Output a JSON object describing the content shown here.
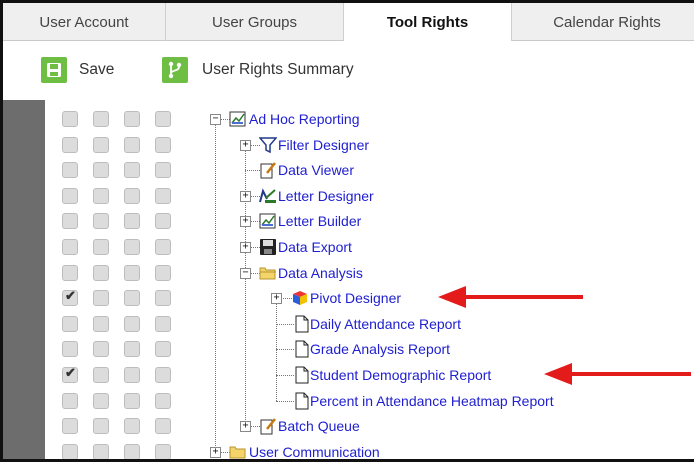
{
  "tabs": [
    {
      "label": "User Account",
      "active": false
    },
    {
      "label": "User Groups",
      "active": false
    },
    {
      "label": "Tool Rights",
      "active": true
    },
    {
      "label": "Calendar Rights",
      "active": false
    }
  ],
  "toolbar": {
    "save_label": "Save",
    "summary_label": "User Rights Summary",
    "accent_color": "#6fbe44"
  },
  "tree": [
    {
      "label": "Ad Hoc Reporting",
      "icon": "report-icon",
      "checked": false
    },
    {
      "label": "Filter Designer",
      "icon": "filter-icon",
      "checked": false
    },
    {
      "label": "Data Viewer",
      "icon": "document-edit-icon",
      "checked": false
    },
    {
      "label": "Letter Designer",
      "icon": "letter-designer-icon",
      "checked": false
    },
    {
      "label": "Letter Builder",
      "icon": "report-icon",
      "checked": false
    },
    {
      "label": "Data Export",
      "icon": "floppy-disk-icon",
      "checked": false
    },
    {
      "label": "Data Analysis",
      "icon": "folder-open-icon",
      "checked": false
    },
    {
      "label": "Pivot Designer",
      "icon": "cube-icon",
      "checked": true
    },
    {
      "label": "Daily Attendance Report",
      "icon": "page-icon",
      "checked": false
    },
    {
      "label": "Grade Analysis Report",
      "icon": "page-icon",
      "checked": false
    },
    {
      "label": "Student Demographic Report",
      "icon": "page-icon",
      "checked": true
    },
    {
      "label": "Percent in Attendance Heatmap Report",
      "icon": "page-icon",
      "checked": false
    },
    {
      "label": "Batch Queue",
      "icon": "document-edit-icon",
      "checked": false
    },
    {
      "label": "User Communication",
      "icon": "folder-icon",
      "checked": false
    }
  ],
  "colors": {
    "link": "#2020d0",
    "annotation_arrow": "#e31b1b",
    "sidebar": "#6d6d6d"
  }
}
